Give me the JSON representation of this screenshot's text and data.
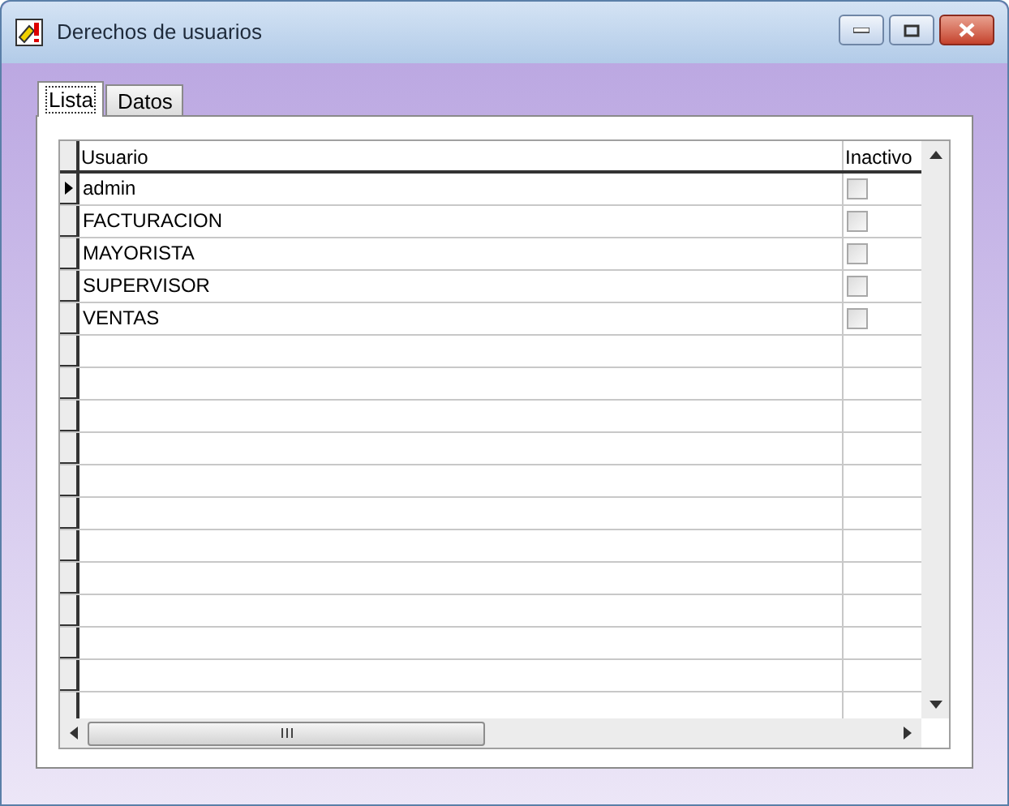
{
  "window": {
    "title": "Derechos de usuarios"
  },
  "tabs": [
    {
      "label": "Lista",
      "selected": true
    },
    {
      "label": "Datos",
      "selected": false
    }
  ],
  "table": {
    "columns": [
      "Usuario",
      "Inactivo"
    ],
    "rows": [
      {
        "usuario": "admin",
        "inactivo": false,
        "selected": true
      },
      {
        "usuario": "FACTURACION",
        "inactivo": false,
        "selected": false
      },
      {
        "usuario": "MAYORISTA",
        "inactivo": false,
        "selected": false
      },
      {
        "usuario": "SUPERVISOR",
        "inactivo": false,
        "selected": false
      },
      {
        "usuario": "VENTAS",
        "inactivo": false,
        "selected": false
      }
    ]
  }
}
